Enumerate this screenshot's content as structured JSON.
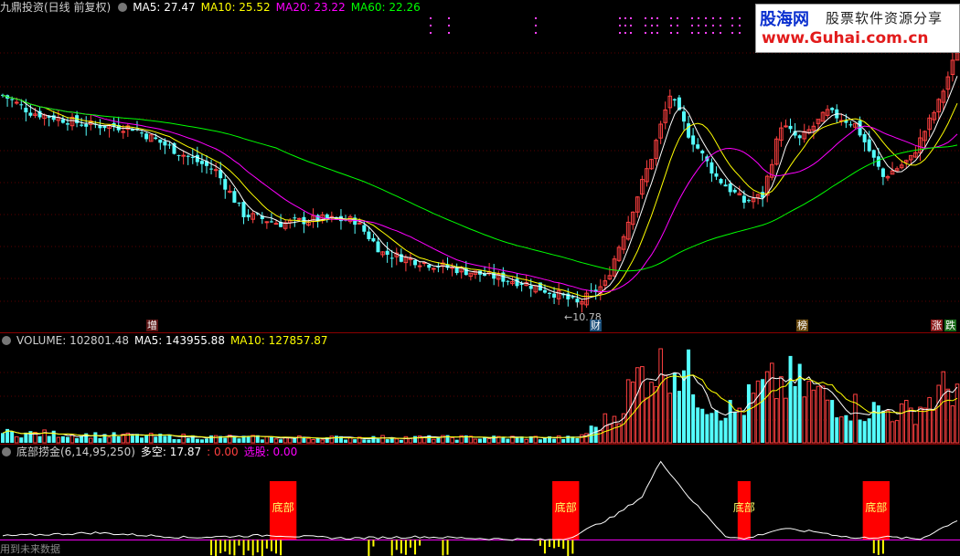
{
  "header": {
    "title": "九鼎投资(日线 前复权)",
    "ma5_label": "MA5: 27.47",
    "ma10_label": "MA10: 25.52",
    "ma20_label": "MA20: 23.22",
    "ma60_label": "MA60: 22.26"
  },
  "logo": {
    "brand": "股海网",
    "slogan": "股票软件资源分享",
    "url": "www.Guhai.com.cn"
  },
  "price_tags": {
    "low_label": "10.78",
    "event_1": "增",
    "event_2": "财",
    "event_3": "榜",
    "event_4": "涨",
    "event_5": "跌"
  },
  "volume_header": {
    "volume_label": "VOLUME: 102801.48",
    "ma5_label": "MA5: 143955.88",
    "ma10_label": "MA10: 127857.87"
  },
  "indicator_header": {
    "name": "底部捞金(6,14,95,250)",
    "duokong_label": "多空: 17.87",
    "value_label": ": 0.00",
    "select_label": "选股: 0.00"
  },
  "indicator_signals": {
    "signal_label": "底部"
  },
  "footer_note": "用到未来数据",
  "colors": {
    "up": "#ff4040",
    "down": "#54ffff",
    "ma5": "#ffffff",
    "ma10": "#ffff00",
    "ma20": "#ff00ff",
    "ma60": "#00ff00",
    "panel_line": "#8b0000",
    "signal": "#ff0000",
    "bars": "#ffff00"
  },
  "chart_data": {
    "type": "candlestick",
    "price_ylim": [
      10,
      29
    ],
    "price_low_marker": 10.78,
    "price_close_anchors": [
      {
        "bar": 0,
        "close": 24.5
      },
      {
        "bar": 6,
        "close": 23.4
      },
      {
        "bar": 18,
        "close": 22.6
      },
      {
        "bar": 28,
        "close": 22.4
      },
      {
        "bar": 38,
        "close": 20.8
      },
      {
        "bar": 46,
        "close": 19.6
      },
      {
        "bar": 52,
        "close": 16.8
      },
      {
        "bar": 60,
        "close": 16.2
      },
      {
        "bar": 68,
        "close": 16.5
      },
      {
        "bar": 76,
        "close": 16.4
      },
      {
        "bar": 82,
        "close": 14.3
      },
      {
        "bar": 92,
        "close": 13.6
      },
      {
        "bar": 102,
        "close": 13.0
      },
      {
        "bar": 112,
        "close": 12.4
      },
      {
        "bar": 120,
        "close": 11.6
      },
      {
        "bar": 124,
        "close": 11.0
      },
      {
        "bar": 130,
        "close": 12.3
      },
      {
        "bar": 136,
        "close": 17.2
      },
      {
        "bar": 140,
        "close": 20.5
      },
      {
        "bar": 144,
        "close": 24.5
      },
      {
        "bar": 148,
        "close": 22.0
      },
      {
        "bar": 154,
        "close": 19.2
      },
      {
        "bar": 160,
        "close": 17.6
      },
      {
        "bar": 164,
        "close": 18.0
      },
      {
        "bar": 168,
        "close": 22.6
      },
      {
        "bar": 172,
        "close": 21.6
      },
      {
        "bar": 178,
        "close": 23.4
      },
      {
        "bar": 184,
        "close": 22.6
      },
      {
        "bar": 190,
        "close": 19.2
      },
      {
        "bar": 196,
        "close": 20.4
      },
      {
        "bar": 202,
        "close": 24.0
      },
      {
        "bar": 206,
        "close": 27.4
      }
    ],
    "volume_anchors": [
      {
        "bar": 0,
        "volume": 30000
      },
      {
        "bar": 30,
        "volume": 20000
      },
      {
        "bar": 60,
        "volume": 15000
      },
      {
        "bar": 100,
        "volume": 16000
      },
      {
        "bar": 124,
        "volume": 15000
      },
      {
        "bar": 132,
        "volume": 80000
      },
      {
        "bar": 138,
        "volume": 210000
      },
      {
        "bar": 144,
        "volume": 260000
      },
      {
        "bar": 152,
        "volume": 130000
      },
      {
        "bar": 158,
        "volume": 90000
      },
      {
        "bar": 164,
        "volume": 160000
      },
      {
        "bar": 170,
        "volume": 180000
      },
      {
        "bar": 178,
        "volume": 130000
      },
      {
        "bar": 186,
        "volume": 100000
      },
      {
        "bar": 196,
        "volume": 90000
      },
      {
        "bar": 206,
        "volume": 180000
      }
    ],
    "volume_ylim": [
      0,
      280000
    ],
    "indicator_anchors": [
      {
        "bar": 0,
        "value": 5
      },
      {
        "bar": 20,
        "value": 9
      },
      {
        "bar": 40,
        "value": 3
      },
      {
        "bar": 58,
        "value": 6
      },
      {
        "bar": 74,
        "value": 2
      },
      {
        "bar": 90,
        "value": 4
      },
      {
        "bar": 108,
        "value": 1
      },
      {
        "bar": 118,
        "value": 0
      },
      {
        "bar": 122,
        "value": 2
      },
      {
        "bar": 132,
        "value": 30
      },
      {
        "bar": 138,
        "value": 55
      },
      {
        "bar": 142,
        "value": 100
      },
      {
        "bar": 148,
        "value": 55
      },
      {
        "bar": 156,
        "value": 5
      },
      {
        "bar": 160,
        "value": 1
      },
      {
        "bar": 168,
        "value": 14
      },
      {
        "bar": 176,
        "value": 10
      },
      {
        "bar": 184,
        "value": 2
      },
      {
        "bar": 190,
        "value": 4
      },
      {
        "bar": 198,
        "value": 1
      },
      {
        "bar": 206,
        "value": 25
      }
    ],
    "indicator_ylim": [
      -10,
      100
    ],
    "signal_ranges": [
      [
        58,
        63
      ],
      [
        119,
        124
      ],
      [
        159,
        161
      ],
      [
        186,
        191
      ]
    ],
    "bar_ranges": [
      [
        45,
        60
      ],
      [
        79,
        80
      ],
      [
        84,
        90
      ],
      [
        95,
        96
      ],
      [
        116,
        123
      ],
      [
        188,
        190
      ]
    ]
  }
}
